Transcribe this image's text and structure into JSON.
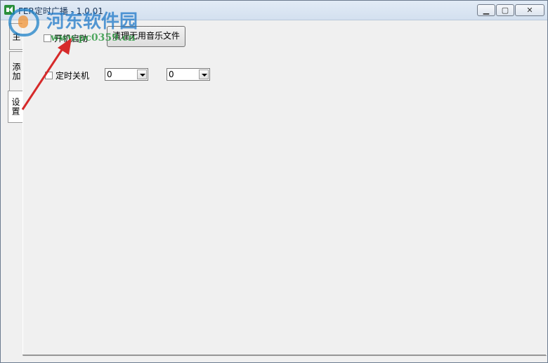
{
  "window": {
    "title": "FER定时广播 - 1.0.01",
    "minimize_icon": "minimize-icon",
    "maximize_icon": "maximize-icon",
    "close_icon": "close-icon"
  },
  "tabs": [
    {
      "label": "主",
      "active": false
    },
    {
      "label": "添加",
      "active": false
    },
    {
      "label": "设置",
      "active": true
    }
  ],
  "settings": {
    "autostart_label": "开机启动",
    "autostart_checked": false,
    "clean_button_label": "清理无用音乐文件",
    "shutdown_label": "定时关机",
    "shutdown_checked": false,
    "hour_value": "0",
    "minute_value": "0"
  },
  "watermark": {
    "name": "河东软件园",
    "url": "www.pc0359.cn"
  },
  "colors": {
    "annotation_arrow": "#d62a2a",
    "title_bar": "#d9e4f1"
  }
}
